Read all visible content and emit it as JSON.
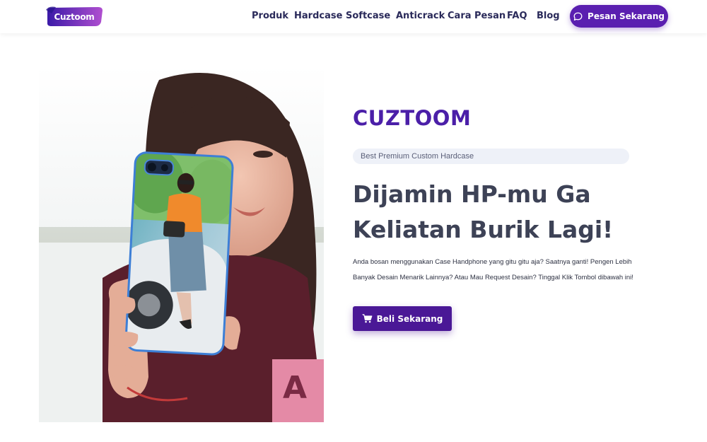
{
  "header": {
    "logo_text": "Cuztoom",
    "nav": [
      "Produk",
      "Hardcase",
      "Softcase",
      "Anticrack",
      "Cara Pesan",
      "FAQ",
      "Blog"
    ],
    "cta_label": "Pesan Sekarang",
    "cta_icon": "chat-bubble-icon"
  },
  "hero": {
    "brand": "CUZTOOM",
    "tagline": "Best Premium Custom Hardcase",
    "headline_line1": "Dijamin HP-mu Ga",
    "headline_line2": "Keliatan Burik Lagi!",
    "description": "Anda bosan menggunakan Case Handphone yang gitu gitu aja? Saatnya ganti! Pengen Lebih Banyak Desain Menarik Lainnya? Atau Mau Request Desain? Tinggal Klik Tombol dibawah ini!",
    "button_label": "Beli Sekarang",
    "button_icon": "cart-icon"
  },
  "colors": {
    "brand": "#4b1fa8",
    "cta": "#5a1fb0",
    "button": "#4a1896",
    "headline": "#3d4256"
  }
}
